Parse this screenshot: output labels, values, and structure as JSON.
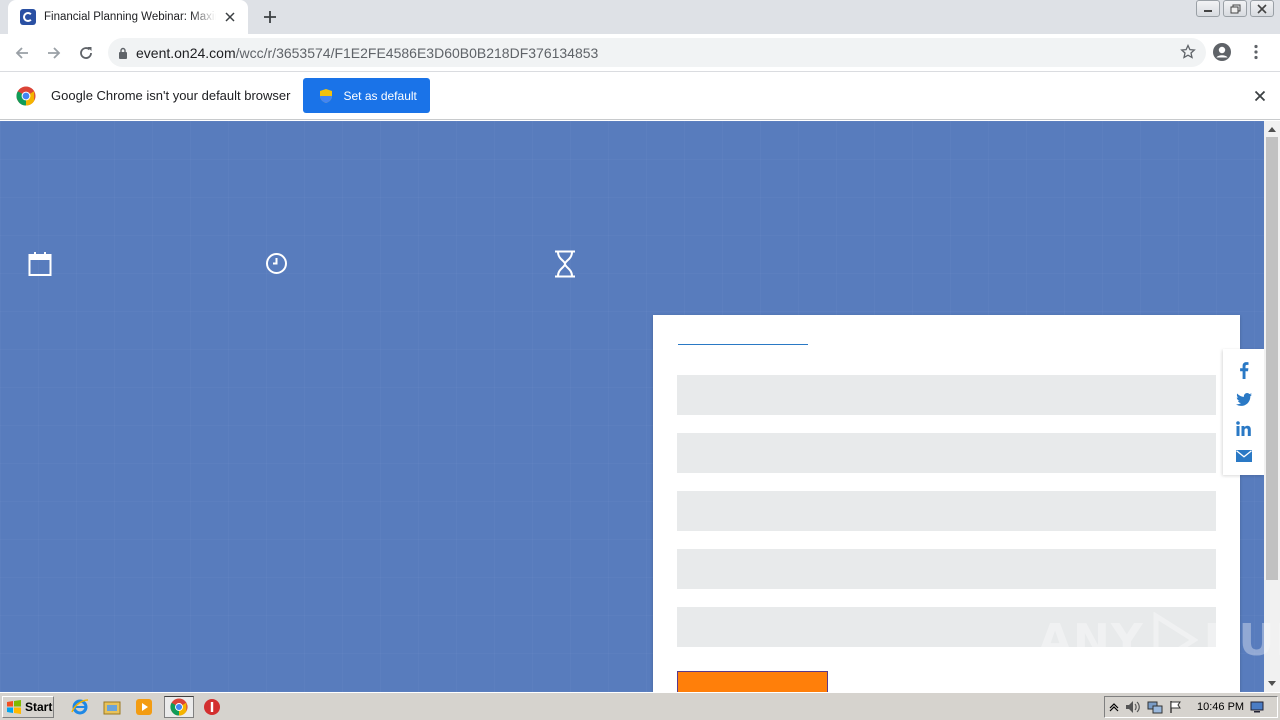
{
  "browser": {
    "tab": {
      "title": "Financial Planning Webinar: Maximizing"
    },
    "address": {
      "host": "event.on24.com",
      "path": "/wcc/r/3653574/F1E2FE4586E3D60B0B218DF376134853"
    },
    "infobar": {
      "message": "Google Chrome isn't your default browser",
      "button_label": "Set as default"
    }
  },
  "page": {
    "icons": [
      "calendar-icon",
      "clock-icon",
      "hourglass-icon"
    ],
    "form_fields": [
      "",
      "",
      "",
      "",
      ""
    ],
    "social": [
      "facebook-icon",
      "twitter-icon",
      "linkedin-icon",
      "email-icon"
    ],
    "background_color": "#587cbd",
    "accent_color": "#ff7f0a"
  },
  "watermark": {
    "text_left": "ANY",
    "text_right": "RUN"
  },
  "taskbar": {
    "start_label": "Start",
    "clock": "10:46 PM"
  }
}
